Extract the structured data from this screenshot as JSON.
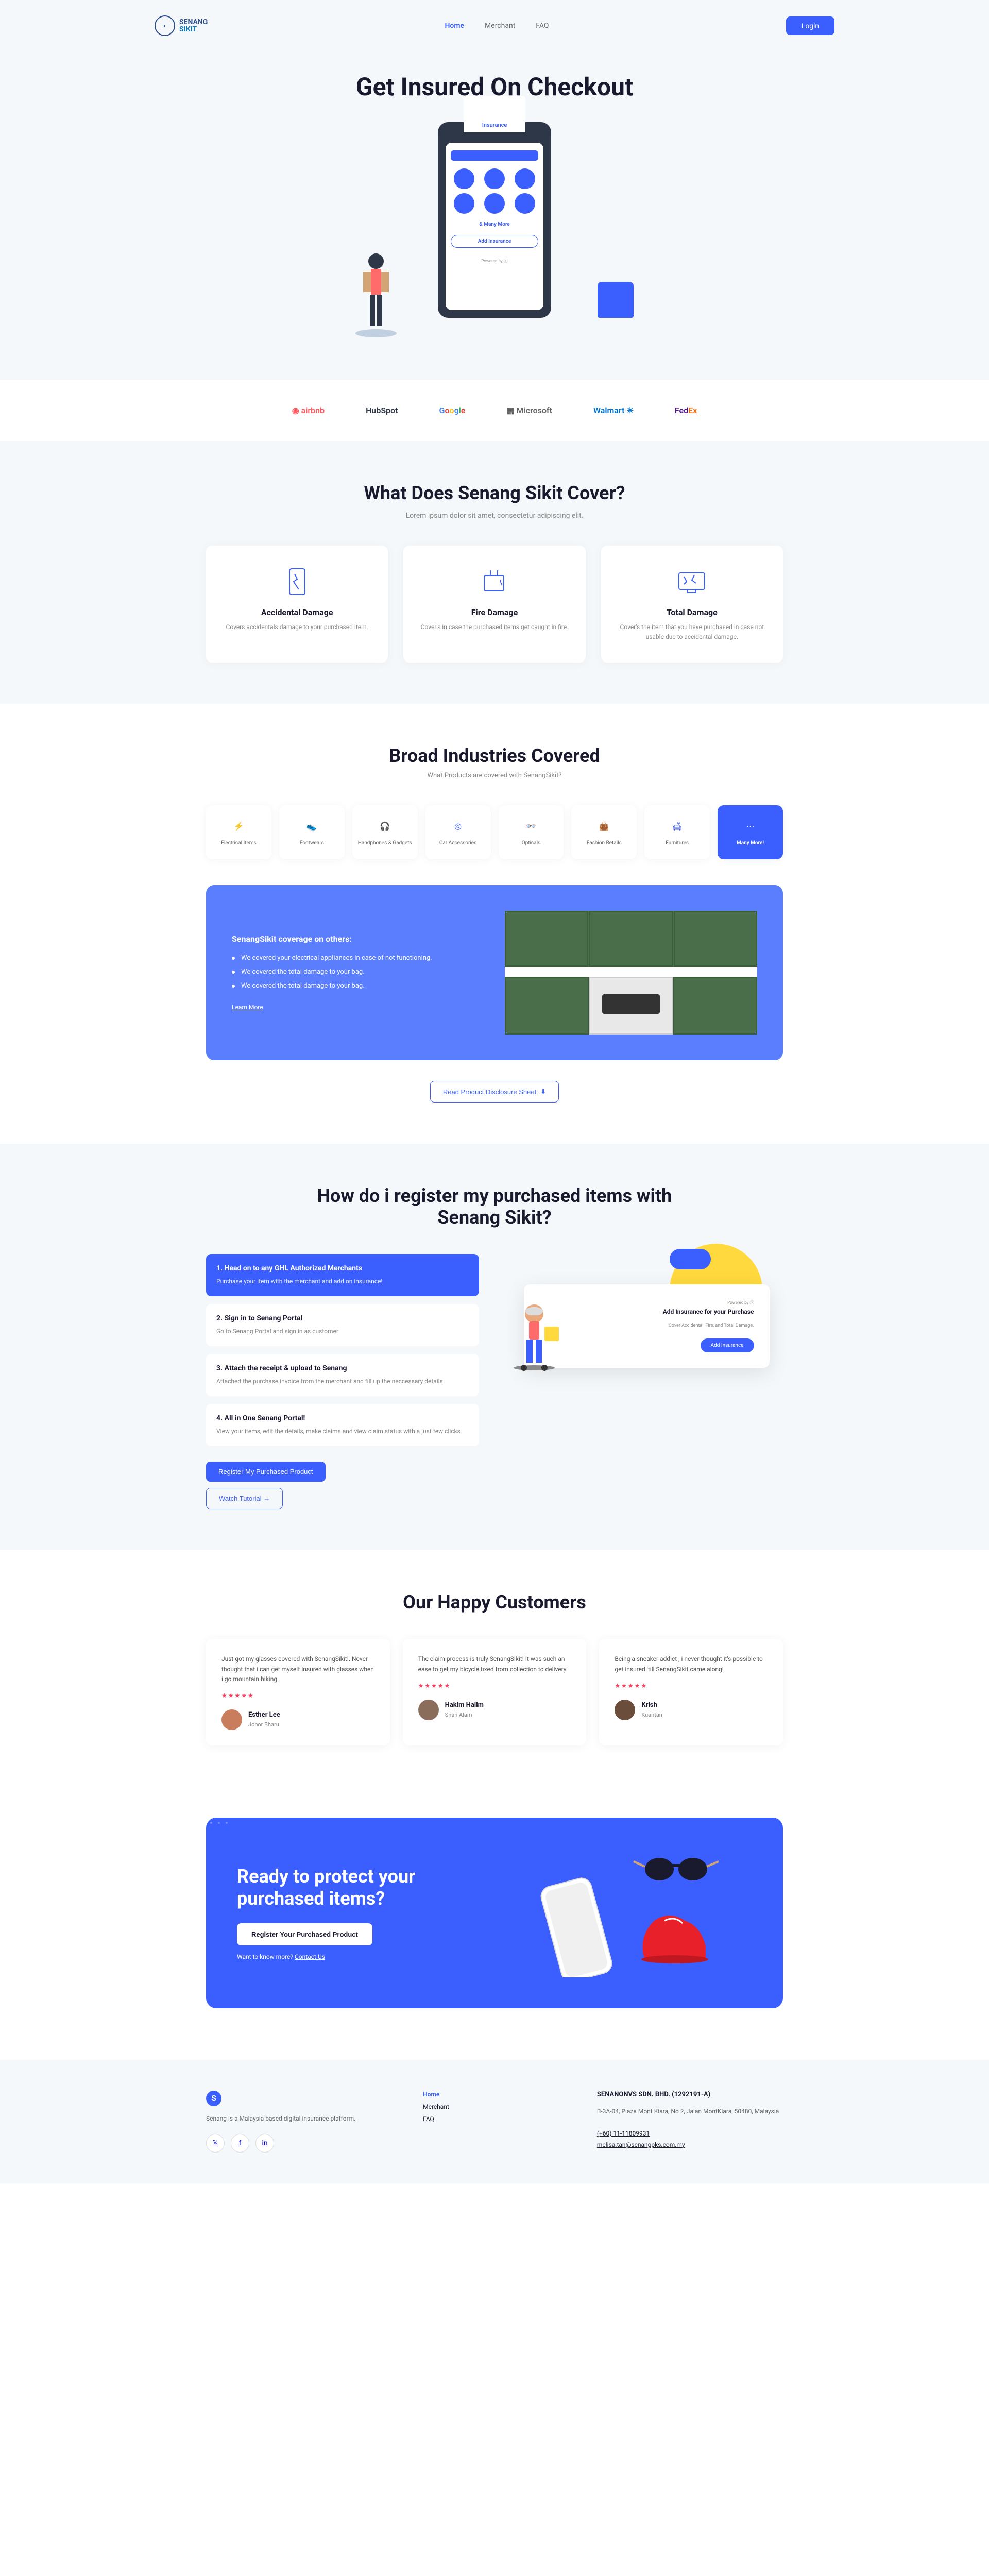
{
  "logo": {
    "line1": "SENANG",
    "line2": "SIKIT"
  },
  "nav": {
    "home": "Home",
    "merchant": "Merchant",
    "faq": "FAQ",
    "login": "Login"
  },
  "hero": {
    "title": "Get Insured On Checkout",
    "receipt": "Insurance",
    "phone_more": "& Many More",
    "phone_add": "Add Insurance",
    "phone_powered": "Powered by"
  },
  "brands": [
    "airbnb",
    "HubSpot",
    "Google",
    "Microsoft",
    "Walmart",
    "FedEx"
  ],
  "cover": {
    "title": "What Does Senang Sikit Cover?",
    "subtitle": "Lorem ipsum dolor sit amet, consectetur adipiscing elit.",
    "cards": [
      {
        "title": "Accidental Damage",
        "desc": "Covers accidentals damage to your purchased item."
      },
      {
        "title": "Fire Damage",
        "desc": "Cover's in case the purchased items get caught in fire."
      },
      {
        "title": "Total Damage",
        "desc": "Cover's the item that you have purchased in case not usable due to accidental damage."
      }
    ]
  },
  "industries": {
    "title": "Broad Industries Covered",
    "subtitle": "What Products are covered with SenangSikit?",
    "items": [
      "Electrical Items",
      "Footwears",
      "Handphones & Gadgets",
      "Car Accessories",
      "Opticals",
      "Fashion Retails",
      "Furnitures",
      "Many More!"
    ],
    "detail_title": "SenangSikit coverage on others:",
    "detail_points": [
      "We covered your electrical appliances in case of not functioning.",
      "We covered the total damage to your bag.",
      "We covered the total damage to your bag."
    ],
    "learn_more": "Learn More",
    "pds_btn": "Read Product Disclosure Sheet"
  },
  "register": {
    "title": "How do i register my purchased items with Senang Sikit?",
    "steps": [
      {
        "title": "1. Head on to any GHL Authorized Merchants",
        "desc": "Purchase your item with the merchant and add on insurance!"
      },
      {
        "title": "2. Sign in to Senang Portal",
        "desc": "Go to Senang Portal and sign in as customer"
      },
      {
        "title": "3. Attach the receipt & upload to Senang",
        "desc": "Attached the purchase invoice from the merchant and fill up the neccessary details"
      },
      {
        "title": "4. All in One Senang Portal!",
        "desc": "View your items, edit the details, make claims and view claim status with a just few clicks"
      }
    ],
    "card_powered": "Powered by",
    "card_title": "Add Insurance for your Purchase",
    "card_sub": "Cover Accidental, Fire, and Total Damage.",
    "card_btn": "Add Insurance",
    "register_btn": "Register My Purchased Product",
    "watch_btn": "Watch Tutorial →"
  },
  "testimonials": {
    "title": "Our Happy Customers",
    "items": [
      {
        "text": "Just got my glasses covered with SenangSikit!. Never thought that i can get myself insured with glasses when i go mountain biking.",
        "name": "Esther Lee",
        "loc": "Johor Bharu"
      },
      {
        "text": "The claim process is truly SenangSikit! It was such an ease to get my bicycle fixed from collection to delivery.",
        "name": "Hakim Halim",
        "loc": "Shah Alam"
      },
      {
        "text": "Being a sneaker addict , i never thought it's possible to get insured 'till SenangSikit came along!",
        "name": "Krish",
        "loc": "Kuantan"
      }
    ],
    "stars": "★★★★★"
  },
  "cta": {
    "title": "Ready to protect your purchased items?",
    "btn": "Register Your Purchased Product",
    "more": "Want to know more?",
    "contact": "Contact Us"
  },
  "footer": {
    "about": "Senang is a Malaysia based digital insurance platform.",
    "links": {
      "home": "Home",
      "merchant": "Merchant",
      "faq": "FAQ"
    },
    "company": "SENANONVS SDN. BHD. (1292191-A)",
    "address": "B-3A-04, Plaza Mont Kiara, No 2, Jalan MontKiara, 50480, Malaysia",
    "phone": "(+60) 11-11809931",
    "email": "melisa.tan@senangpks.com.my"
  }
}
